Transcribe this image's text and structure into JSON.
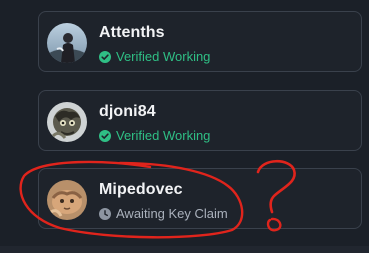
{
  "users": [
    {
      "name": "Attenths",
      "status": "Verified Working",
      "status_type": "verified",
      "status_icon": "check-circle-icon"
    },
    {
      "name": "djoni84",
      "status": "Verified Working",
      "status_type": "verified",
      "status_icon": "check-circle-icon"
    },
    {
      "name": "Mipedovec",
      "status": "Awaiting Key Claim",
      "status_type": "awaiting",
      "status_icon": "clock-icon"
    }
  ],
  "annotation": {
    "mark": "?",
    "color": "#e0241c"
  },
  "colors": {
    "verified": "#2fbf85",
    "awaiting": "#aab1bc",
    "card_border": "#3a414c",
    "background": "#1b2028"
  }
}
